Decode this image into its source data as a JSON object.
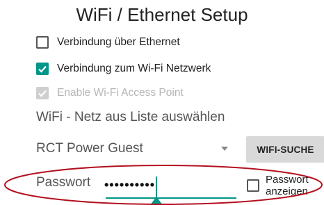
{
  "title": "WiFi / Ethernet Setup",
  "options": {
    "ethernet": {
      "label": "Verbindung über Ethernet",
      "checked": false,
      "enabled": true
    },
    "wifi": {
      "label": "Verbindung zum Wi-Fi Netzwerk",
      "checked": true,
      "enabled": true
    },
    "access_point": {
      "label": "Enable Wi-Fi Access Point",
      "checked": true,
      "enabled": false
    }
  },
  "network_section": {
    "label": "WiFi - Netz aus Liste auswählen",
    "selected_network": "RCT Power Guest",
    "search_button": "WIFI-SUCHE"
  },
  "password": {
    "label": "Passwort",
    "value": "••••••••••",
    "show_label_line1": "Passwort",
    "show_label_line2": "anzeigen",
    "show_checked": false
  },
  "colors": {
    "accent": "#009688",
    "annotation": "#b3101e"
  }
}
